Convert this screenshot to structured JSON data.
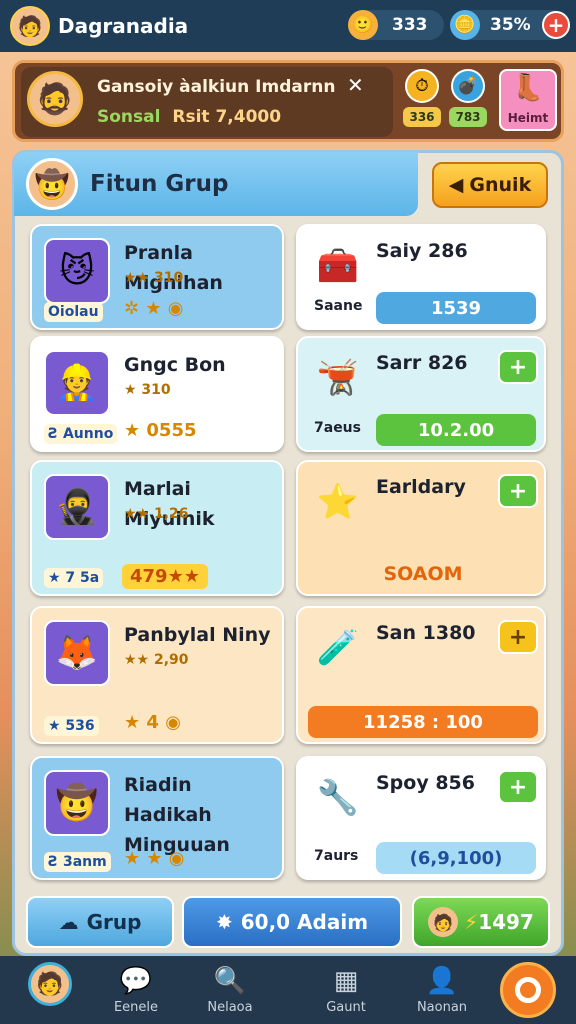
{
  "header": {
    "title": "Dagranadia",
    "coins": "333",
    "gems": "35%"
  },
  "banner": {
    "line1": "Gansoiy àalkiun Imdarnn",
    "line2_label": "Sonsal",
    "line2_value": "Rsit 7,4000",
    "stats": [
      {
        "icon": "clock-icon",
        "value": "336"
      },
      {
        "icon": "bomb-icon",
        "value": "783"
      },
      {
        "icon": "boot-icon",
        "value": "Heimt"
      }
    ]
  },
  "panel": {
    "title": "Fitun Grup",
    "back_label": "Gnuik"
  },
  "left_cards": [
    {
      "title": "Pranla Mignihan",
      "rating": "★★ 310",
      "badge": "Oiolau",
      "row": "✲ ★ ◉",
      "bg": "#8fcbef",
      "icon": "cat-hero-icon"
    },
    {
      "title": "Gngc Bon",
      "rating": "★ 310",
      "badge": "Ƨ Aunno",
      "row": "★ 0555",
      "bg": "#ffffff",
      "icon": "helmet-hero-icon"
    },
    {
      "title": "Marlai Miyuinik",
      "rating": "★★ 1,26",
      "badge": "★ 7 5a",
      "row": "479★★",
      "bg": "#c8eef3",
      "icon": "ninja-icon"
    },
    {
      "title": "Panbylal Niny",
      "rating": "★★ 2,90",
      "badge": "★ 536",
      "row": "★ 4 ◉",
      "bg": "#fde6c4",
      "icon": "fox-icon"
    },
    {
      "title": "Riadin Hadikah Minguuan",
      "rating": "",
      "badge": "Ƨ 3anm",
      "row": "★ ★ ◉",
      "bg": "#8fcbef",
      "icon": "cowboy-icon"
    }
  ],
  "right_cards": [
    {
      "title": "Saiy 286",
      "sub": "Saane",
      "bar": "1539",
      "bar_color": "#4fa9e0",
      "plus": false,
      "bg": "#ffffff",
      "icon": "chest-icon"
    },
    {
      "title": "Sarr 826",
      "sub": "7aeus",
      "bar": "10.2.00",
      "bar_color": "#5cc33e",
      "plus": true,
      "plus_style": "green",
      "bg": "#d9f2f6",
      "icon": "cauldron-icon"
    },
    {
      "title": "Earldary",
      "sub": "",
      "bar": "SOAOM",
      "bar_color": "transparent",
      "plus": true,
      "plus_style": "green",
      "bg": "#fde0b3",
      "icon": "star-icon"
    },
    {
      "title": "San 1380",
      "sub": "",
      "bar": "11258 : 100",
      "bar_color": "#f37b22",
      "plus": true,
      "plus_style": "yellow",
      "bg": "#fde6c4",
      "icon": "potion-icon"
    },
    {
      "title": "Spoy 856",
      "sub": "7aurs",
      "bar": "(6,9,100)",
      "bar_color": "#a6dbf5",
      "plus": true,
      "plus_style": "green",
      "bg": "#ffffff",
      "icon": "tools-icon"
    }
  ],
  "bottom_buttons": {
    "grup": "Grup",
    "center": "60,0 Adaim",
    "right": "1497"
  },
  "nav": [
    {
      "label": "",
      "icon": "profile-avatar-icon"
    },
    {
      "label": "Eenele",
      "icon": "chat-icon"
    },
    {
      "label": "Nelaoa",
      "icon": "search-icon"
    },
    {
      "label": "Gaunt",
      "icon": "grid-icon"
    },
    {
      "label": "Naonan",
      "icon": "user-icon"
    },
    {
      "label": "",
      "icon": "ring-icon"
    }
  ],
  "colors": {
    "topbar": "#1f3d57",
    "accent_orange": "#f37b22",
    "accent_green": "#5cc33e",
    "accent_blue": "#5cb5e8"
  }
}
